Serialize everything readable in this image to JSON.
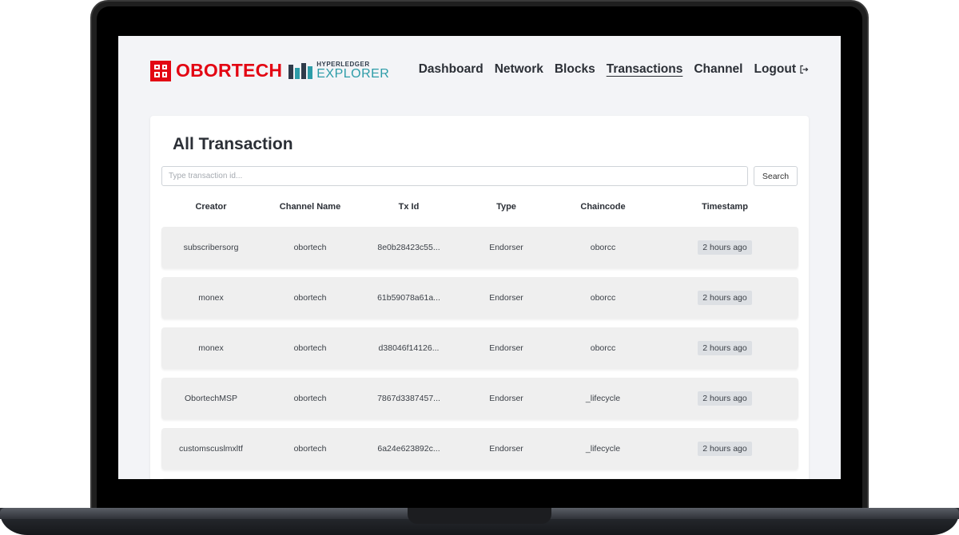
{
  "brand": {
    "name": "OBORTECH",
    "partner_top": "HYPERLEDGER",
    "partner_bottom": "EXPLORER",
    "colors": {
      "brand_red": "#e30613",
      "partner_teal": "#2d9ca8",
      "partner_dark": "#2f3b4a"
    }
  },
  "nav": {
    "items": [
      {
        "label": "Dashboard",
        "active": false
      },
      {
        "label": "Network",
        "active": false
      },
      {
        "label": "Blocks",
        "active": false
      },
      {
        "label": "Transactions",
        "active": true
      },
      {
        "label": "Channel",
        "active": false
      }
    ],
    "logout_label": "Logout",
    "logout_icon": "logout-icon"
  },
  "page": {
    "title": "All Transaction"
  },
  "search": {
    "placeholder": "Type transaction id...",
    "value": "",
    "button_label": "Search"
  },
  "table": {
    "columns": [
      "Creator",
      "Channel Name",
      "Tx Id",
      "Type",
      "Chaincode",
      "Timestamp"
    ],
    "rows": [
      [
        "subscribersorg",
        "obortech",
        "8e0b28423c55...",
        "Endorser",
        "oborcc",
        "2 hours ago"
      ],
      [
        "monex",
        "obortech",
        "61b59078a61a...",
        "Endorser",
        "oborcc",
        "2 hours ago"
      ],
      [
        "monex",
        "obortech",
        "d38046f14126...",
        "Endorser",
        "oborcc",
        "2 hours ago"
      ],
      [
        "ObortechMSP",
        "obortech",
        "7867d3387457...",
        "Endorser",
        "_lifecycle",
        "2 hours ago"
      ],
      [
        "customscuslmxltf",
        "obortech",
        "6a24e623892c...",
        "Endorser",
        "_lifecycle",
        "2 hours ago"
      ]
    ]
  }
}
